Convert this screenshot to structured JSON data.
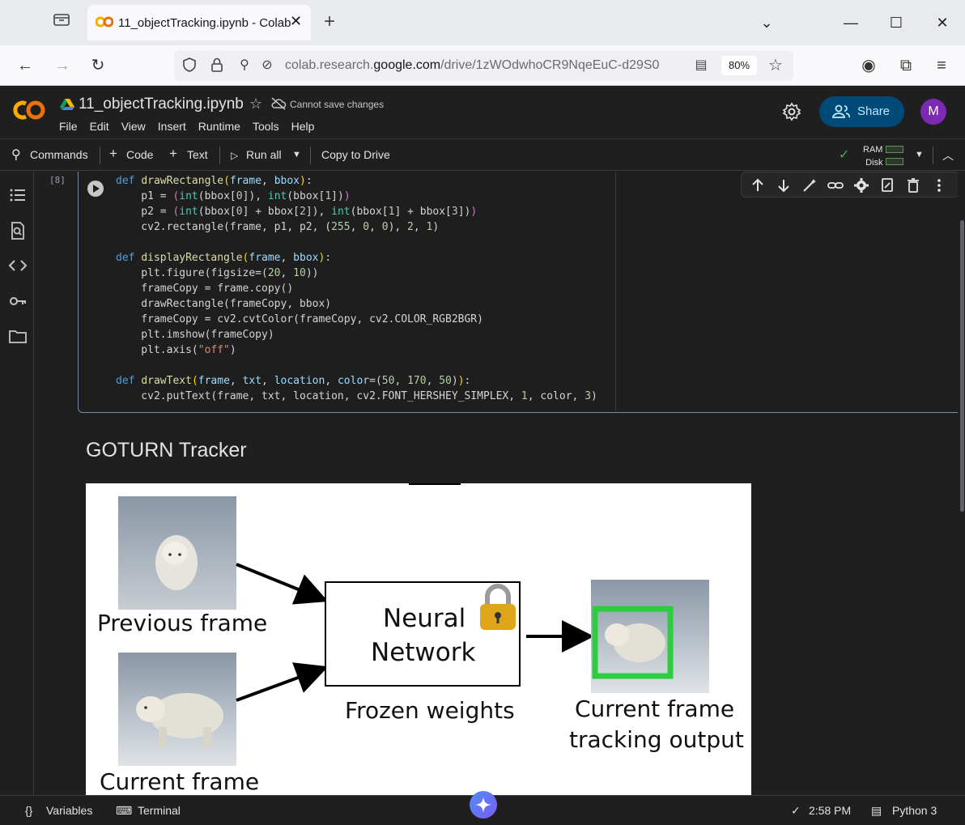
{
  "browser": {
    "tab_title": "11_objectTracking.ipynb - Colab",
    "url_gray_prefix": "colab.research.",
    "url_domain": "google.com",
    "url_rest": "/drive/1zWOdwhoCR9NqeEuC-d29S0",
    "zoom": "80%"
  },
  "colab": {
    "notebook_name": "11_objectTracking.ipynb",
    "save_status": "Cannot save changes",
    "menu": [
      "File",
      "Edit",
      "View",
      "Insert",
      "Runtime",
      "Tools",
      "Help"
    ],
    "share_label": "Share",
    "avatar_letter": "M"
  },
  "toolbar": {
    "commands": "Commands",
    "code": "Code",
    "text": "Text",
    "run_all": "Run all",
    "copy_to_drive": "Copy to Drive",
    "ram": "RAM",
    "disk": "Disk"
  },
  "cell": {
    "execution_count": "[8]",
    "code_lines": [
      "def drawRectangle(frame, bbox):",
      "    p1 = (int(bbox[0]), int(bbox[1]))",
      "    p2 = (int(bbox[0] + bbox[2]), int(bbox[1] + bbox[3]))",
      "    cv2.rectangle(frame, p1, p2, (255, 0, 0), 2, 1)",
      "",
      "def displayRectangle(frame, bbox):",
      "    plt.figure(figsize=(20, 10))",
      "    frameCopy = frame.copy()",
      "    drawRectangle(frameCopy, bbox)",
      "    frameCopy = cv2.cvtColor(frameCopy, cv2.COLOR_RGB2BGR)",
      "    plt.imshow(frameCopy)",
      "    plt.axis(\"off\")",
      "",
      "def drawText(frame, txt, location, color=(50, 170, 50)):",
      "    cv2.putText(frame, txt, location, cv2.FONT_HERSHEY_SIMPLEX, 1, color, 3)"
    ]
  },
  "text_cell": {
    "heading": "GOTURN Tracker"
  },
  "figure": {
    "previous_frame": "Previous frame",
    "current_frame": "Current frame",
    "network_line1": "Neural",
    "network_line2": "Network",
    "frozen_weights": "Frozen weights",
    "output_line1": "Current frame",
    "output_line2": "tracking output"
  },
  "statusbar": {
    "variables": "Variables",
    "terminal": "Terminal",
    "time": "2:58 PM",
    "kernel": "Python 3"
  },
  "colors": {
    "accent": "#004a77",
    "avatar": "#7b2ab1",
    "tracking_box": "#2ecc40"
  }
}
